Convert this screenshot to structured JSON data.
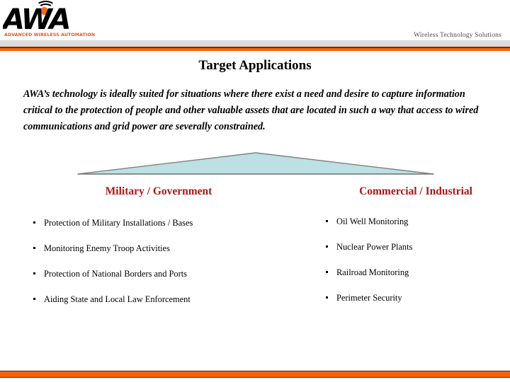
{
  "header": {
    "logo": {
      "wordmark": "AWA",
      "tagline": "ADVANCED WIRELESS AUTOMATION",
      "dot_color": "#F26B21"
    },
    "right_tagline": "Wireless Technology Solutions",
    "accent_color": "#F96302",
    "band_color": "#dcdcdc"
  },
  "slide": {
    "title": "Target Applications",
    "intro": "AWA’s technology is ideally suited for situations where there exist a need and desire to capture information critical to the protection of people and other valuable assets that are located  in such a way that access to wired communications and grid power are severally constrained."
  },
  "diagram": {
    "name": "flat-triangle-banner",
    "fill_color": "#BDE0E4",
    "stroke_color": "#808080"
  },
  "columns": [
    {
      "heading": "Military / Government",
      "heading_color": "#B01515",
      "items": [
        "Protection of Military Installations / Bases",
        "Monitoring Enemy Troop Activities",
        "Protection of National Borders and Ports",
        "Aiding State and Local Law Enforcement"
      ]
    },
    {
      "heading": "Commercial / Industrial",
      "heading_color": "#B01515",
      "items": [
        "Oil Well Monitoring",
        "Nuclear Power Plants",
        "Railroad Monitoring",
        "Perimeter Security"
      ]
    }
  ]
}
